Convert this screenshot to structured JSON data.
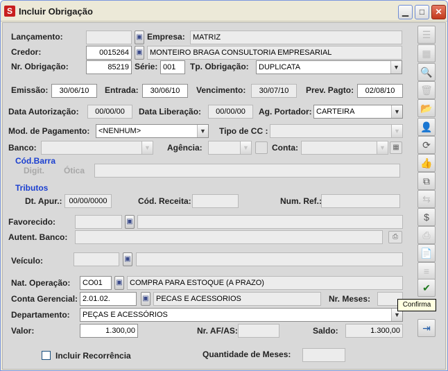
{
  "window": {
    "title": "Incluir Obrigação",
    "app_icon": "S"
  },
  "form": {
    "lancamento": {
      "label": "Lançamento:",
      "value": ""
    },
    "empresa": {
      "label": "Empresa:",
      "value": "MATRIZ"
    },
    "credor": {
      "label": "Credor:",
      "code": "0015264",
      "name": "MONTEIRO BRAGA CONSULTORIA EMPRESARIAL"
    },
    "nr_obrigacao": {
      "label": "Nr. Obrigação:",
      "value": "85219"
    },
    "serie": {
      "label": "Série:",
      "value": "001"
    },
    "tp_obrigacao": {
      "label": "Tp. Obrigação:",
      "value": "DUPLICATA"
    },
    "emissao": {
      "label": "Emissão:",
      "value": "30/06/10"
    },
    "entrada": {
      "label": "Entrada:",
      "value": "30/06/10"
    },
    "vencimento": {
      "label": "Vencimento:",
      "value": "30/07/10"
    },
    "prev_pagto": {
      "label": "Prev. Pagto:",
      "value": "02/08/10"
    },
    "data_autorizacao": {
      "label": "Data Autorização:",
      "value": "00/00/00"
    },
    "data_liberacao": {
      "label": "Data Liberação:",
      "value": "00/00/00"
    },
    "ag_portador": {
      "label": "Ag. Portador:",
      "value": "CARTEIRA"
    },
    "mod_pagamento": {
      "label": "Mod. de Pagamento:",
      "value": "<NENHUM>"
    },
    "tipo_cc": {
      "label": "Tipo de CC :",
      "value": ""
    },
    "banco": {
      "label": "Banco:",
      "value": ""
    },
    "agencia": {
      "label": "Agência:",
      "value": ""
    },
    "conta": {
      "label": "Conta:",
      "value": ""
    },
    "cod_barra": {
      "label": "Cód.Barra",
      "digit": "Digit.",
      "otica": "Ótica",
      "value": ""
    },
    "tributos": {
      "label": "Tributos"
    },
    "dt_apur": {
      "label": "Dt. Apur.:",
      "value": "00/00/0000"
    },
    "cod_receita": {
      "label": "Cód. Receita:",
      "value": ""
    },
    "num_ref": {
      "label": "Num. Ref.:",
      "value": ""
    },
    "favorecido": {
      "label": "Favorecido:",
      "code": "",
      "name": ""
    },
    "autent_banco": {
      "label": "Autent. Banco:",
      "value": ""
    },
    "veiculo": {
      "label": "Veículo:",
      "code": "",
      "name": ""
    },
    "nat_operacao": {
      "label": "Nat. Operação:",
      "code": "CO01",
      "name": "COMPRA PARA ESTOQUE (A PRAZO)"
    },
    "conta_gerencial": {
      "label": "Conta Gerencial:",
      "code": "2.01.02.",
      "name": "PECAS E ACESSORIOS"
    },
    "nr_meses": {
      "label": "Nr. Meses:",
      "value": ""
    },
    "departamento": {
      "label": "Departamento:",
      "value": "PEÇAS E ACESSÓRIOS"
    },
    "valor": {
      "label": "Valor:",
      "value": "1.300,00"
    },
    "nr_af_as": {
      "label": "Nr. AF/AS:",
      "value": ""
    },
    "saldo": {
      "label": "Saldo:",
      "value": "1.300,00"
    },
    "incluir_recorrencia": {
      "label": "Incluir Recorrência",
      "checked": false
    },
    "quantidade_meses": {
      "label": "Quantidade de Meses:",
      "value": ""
    }
  },
  "toolbar": {
    "tooltip": "Confirma",
    "buttons": [
      {
        "icon": "tree-icon",
        "glyph": "☰"
      },
      {
        "icon": "grid-icon",
        "glyph": "▦"
      },
      {
        "icon": "preview-icon",
        "glyph": "🔍"
      },
      {
        "icon": "trash-icon",
        "glyph": "🗑"
      },
      {
        "icon": "folder-icon",
        "glyph": "📂"
      },
      {
        "icon": "user-icon",
        "glyph": "👤"
      },
      {
        "icon": "refresh-icon",
        "glyph": "⟳"
      },
      {
        "icon": "thumbs-up-icon",
        "glyph": "👍"
      },
      {
        "icon": "copy-icon",
        "glyph": "⧉"
      },
      {
        "icon": "transfer-icon",
        "glyph": "⇆"
      },
      {
        "icon": "money-bag-icon",
        "glyph": "$"
      },
      {
        "icon": "print-icon",
        "glyph": "⎙"
      },
      {
        "icon": "document-icon",
        "glyph": "📄"
      },
      {
        "icon": "stack-icon",
        "glyph": "≡"
      },
      {
        "icon": "confirm-icon",
        "glyph": "✔"
      },
      {
        "icon": "exit-icon",
        "glyph": "⇥"
      }
    ]
  }
}
